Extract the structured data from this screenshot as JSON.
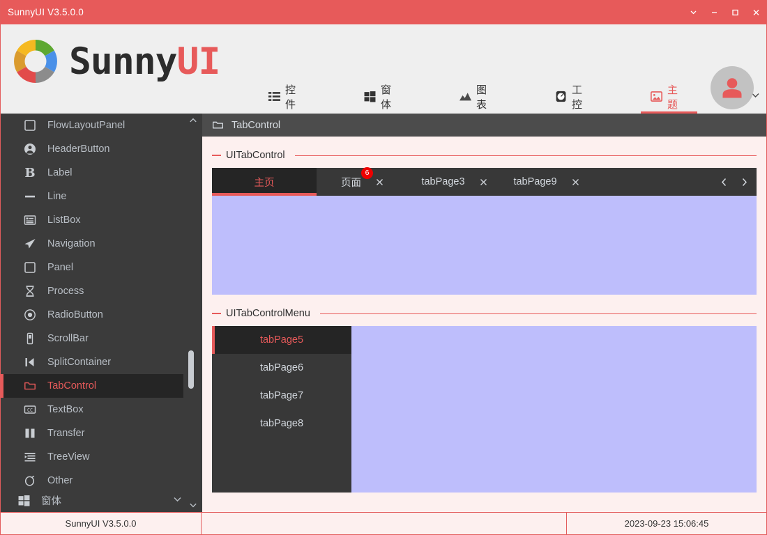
{
  "window": {
    "title": "SunnyUI V3.5.0.0",
    "controls": [
      {
        "name": "extend-button",
        "icon": "chevron-down-icon"
      },
      {
        "name": "minimize-button",
        "icon": "minimize-icon"
      },
      {
        "name": "maximize-button",
        "icon": "maximize-icon"
      },
      {
        "name": "close-button",
        "icon": "close-icon"
      }
    ],
    "accent_color": "#E75A5A",
    "titlebar_color": "#E75A5A"
  },
  "header": {
    "logo_text_main": "Sunny",
    "logo_text_accent": "UI",
    "logo_icon": "sunny-donut-logo-icon",
    "logo_segment_colors": [
      "#F5B921",
      "#5EA832",
      "#4A90E8",
      "#8C8C8C",
      "#E24B4B",
      "#DA9B2E"
    ],
    "avatar_icon": "user-avatar-icon",
    "nav": [
      {
        "label": "控件",
        "icon": "list-icon",
        "active": false
      },
      {
        "label": "窗体",
        "icon": "windows-icon",
        "active": false
      },
      {
        "label": "图表",
        "icon": "chart-icon",
        "active": false
      },
      {
        "label": "工控",
        "icon": "gauge-icon",
        "active": false
      },
      {
        "label": "主题",
        "icon": "image-icon",
        "active": true
      }
    ],
    "nav_more_icon": "chevron-down-icon"
  },
  "sidebar": {
    "items": [
      {
        "label": "FlowLayoutPanel",
        "icon": "square-icon",
        "active": false
      },
      {
        "label": "HeaderButton",
        "icon": "user-circle-icon",
        "active": false
      },
      {
        "label": "Label",
        "icon": "bold-b-icon",
        "active": false
      },
      {
        "label": "Line",
        "icon": "dash-icon",
        "active": false
      },
      {
        "label": "ListBox",
        "icon": "listbox-icon",
        "active": false
      },
      {
        "label": "Navigation",
        "icon": "paper-plane-icon",
        "active": false
      },
      {
        "label": "Panel",
        "icon": "square-icon",
        "active": false
      },
      {
        "label": "Process",
        "icon": "hourglass-icon",
        "active": false
      },
      {
        "label": "RadioButton",
        "icon": "radio-icon",
        "active": false
      },
      {
        "label": "ScrollBar",
        "icon": "scrollbar-icon",
        "active": false
      },
      {
        "label": "SplitContainer",
        "icon": "split-icon",
        "active": false
      },
      {
        "label": "TabControl",
        "icon": "folder-icon",
        "active": true
      },
      {
        "label": "TextBox",
        "icon": "cc-box-icon",
        "active": false
      },
      {
        "label": "Transfer",
        "icon": "transfer-icon",
        "active": false
      },
      {
        "label": "TreeView",
        "icon": "treeview-icon",
        "active": false
      },
      {
        "label": "Other",
        "icon": "circle-arrow-icon",
        "active": false
      }
    ],
    "bottom": {
      "label": "窗体",
      "icon": "windows-icon",
      "chevron": "chevron-down-icon"
    },
    "scrollbar": {
      "up_icon": "chevron-up-icon",
      "down_icon": "chevron-down-icon"
    }
  },
  "main": {
    "header": {
      "title": "TabControl",
      "icon": "folder-icon"
    },
    "groups": [
      {
        "title": "UITabControl"
      },
      {
        "title": "UITabControlMenu"
      }
    ],
    "tabcontrol": {
      "tabs": [
        {
          "label": "主页",
          "active": true,
          "closable": false,
          "badge": null
        },
        {
          "label": "页面",
          "active": false,
          "closable": true,
          "badge": "6"
        },
        {
          "label": "tabPage3",
          "active": false,
          "closable": true,
          "badge": null
        },
        {
          "label": "tabPage9",
          "active": false,
          "closable": true,
          "badge": null
        }
      ],
      "nav_prev_icon": "chevron-left-icon",
      "nav_next_icon": "chevron-right-icon",
      "page_color": "#BEBEFC"
    },
    "tabcontrolmenu": {
      "items": [
        {
          "label": "tabPage5",
          "active": true
        },
        {
          "label": "tabPage6",
          "active": false
        },
        {
          "label": "tabPage7",
          "active": false
        },
        {
          "label": "tabPage8",
          "active": false
        }
      ],
      "page_color": "#BEBEFC"
    }
  },
  "statusbar": {
    "left": "SunnyUI V3.5.0.0",
    "middle": "",
    "right": "2023-09-23 15:06:45"
  }
}
